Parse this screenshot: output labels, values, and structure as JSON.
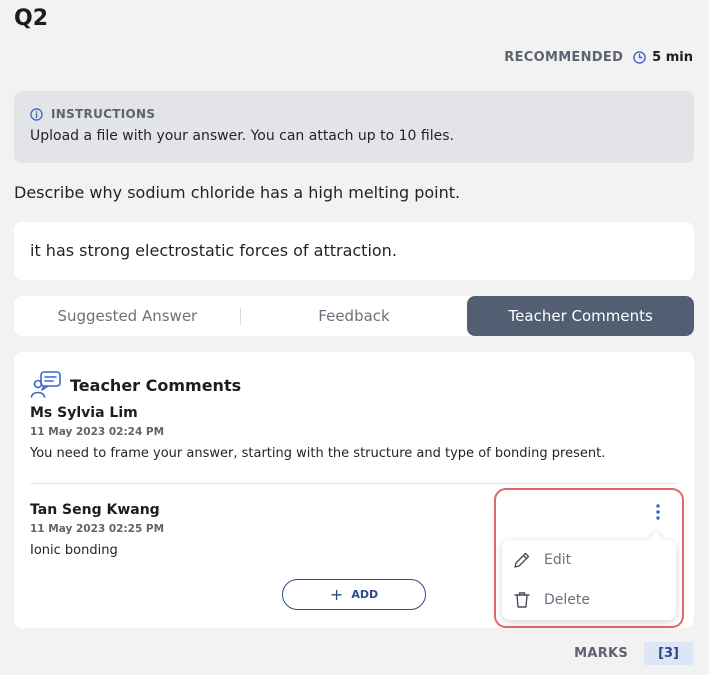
{
  "question": {
    "number": "Q2",
    "recommended_label": "RECOMMENDED",
    "recommended_time": "5 min",
    "instructions_label": "INSTRUCTIONS",
    "instructions_text": "Upload a file with your answer. You can attach up to 10 files.",
    "prompt": "Describe why sodium chloride has a high melting point.",
    "student_answer": "it has strong electrostatic forces of attraction."
  },
  "tabs": [
    {
      "label": "Suggested Answer",
      "active": false
    },
    {
      "label": "Feedback",
      "active": false
    },
    {
      "label": "Teacher Comments",
      "active": true
    }
  ],
  "teacher_comments": {
    "title": "Teacher Comments",
    "comments": [
      {
        "author": "Ms Sylvia Lim",
        "date": "11 May 2023 02:24 PM",
        "text": "You need to frame your answer, starting with the structure and type of bonding present."
      },
      {
        "author": "Tan Seng Kwang",
        "date": "11 May 2023 02:25 PM",
        "text": "Ionic bonding"
      }
    ],
    "add_label": "ADD"
  },
  "context_menu": {
    "edit_label": "Edit",
    "delete_label": "Delete"
  },
  "marks": {
    "label": "MARKS",
    "value": "[3]"
  },
  "colors": {
    "accent": "#2a4a8a",
    "active_tab": "#525e72",
    "highlight": "#e06767"
  }
}
